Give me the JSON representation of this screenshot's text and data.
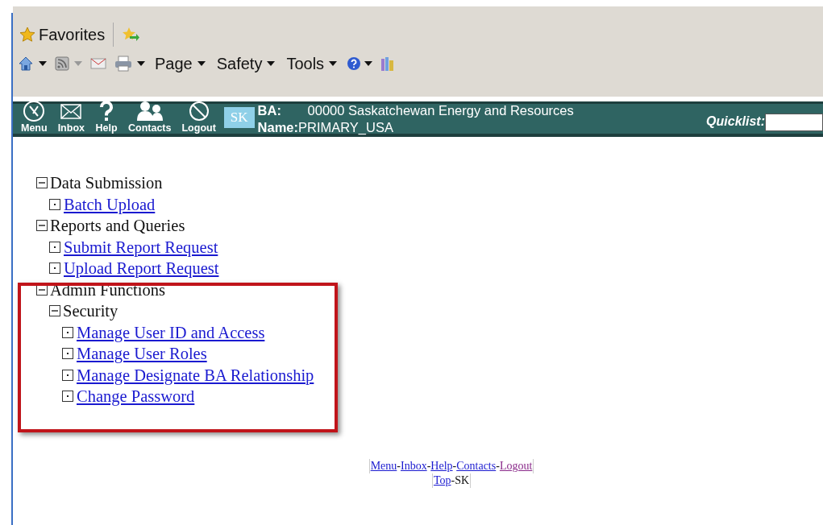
{
  "browser": {
    "favorites": "Favorites",
    "commands": [
      {
        "kind": "home"
      },
      {
        "kind": "feeds"
      },
      {
        "kind": "mail"
      },
      {
        "kind": "print"
      },
      {
        "kind": "menu",
        "label": "Page"
      },
      {
        "kind": "menu",
        "label": "Safety"
      },
      {
        "kind": "menu",
        "label": "Tools"
      },
      {
        "kind": "help"
      },
      {
        "kind": "research"
      }
    ]
  },
  "header": {
    "buttons": [
      {
        "kind": "menu",
        "label": "Menu"
      },
      {
        "kind": "inbox",
        "label": "Inbox"
      },
      {
        "kind": "help",
        "label": "Help"
      },
      {
        "kind": "contacts",
        "label": "Contacts"
      },
      {
        "kind": "logout",
        "label": "Logout"
      }
    ],
    "badge": "SK",
    "ba_label": "BA:",
    "ba_value": "00000 Saskatchewan Energy and Resources",
    "name_label": "Name:",
    "name_value": "PRIMARY_USA",
    "quicklist_label": "Quicklist:"
  },
  "tree": [
    {
      "kind": "group",
      "label": "Data Submission",
      "expanded": true,
      "children": [
        {
          "kind": "link",
          "label": "Batch Upload"
        }
      ]
    },
    {
      "kind": "group",
      "label": "Reports and Queries",
      "expanded": true,
      "children": [
        {
          "kind": "link",
          "label": "Submit Report Request"
        },
        {
          "kind": "link",
          "label": "Upload Report Request"
        }
      ]
    },
    {
      "kind": "group",
      "label": "Admin Functions",
      "expanded": true,
      "children": [
        {
          "kind": "group",
          "label": "Security",
          "expanded": true,
          "children": [
            {
              "kind": "link",
              "label": "Manage User ID and Access"
            },
            {
              "kind": "link",
              "label": "Manage User Roles"
            },
            {
              "kind": "link",
              "label": "Manage Designate BA Relationship"
            },
            {
              "kind": "link",
              "label": "Change Password"
            }
          ]
        }
      ]
    }
  ],
  "footer": [
    [
      {
        "kind": "link",
        "text": "Menu",
        "visited": false
      },
      {
        "kind": "text",
        "text": "-"
      },
      {
        "kind": "link",
        "text": "Inbox",
        "visited": false
      },
      {
        "kind": "text",
        "text": "-"
      },
      {
        "kind": "link",
        "text": "Help",
        "visited": false
      },
      {
        "kind": "text",
        "text": "-"
      },
      {
        "kind": "link",
        "text": "Contacts",
        "visited": false
      },
      {
        "kind": "text",
        "text": "-"
      },
      {
        "kind": "link",
        "text": "Logout",
        "visited": true
      }
    ],
    [
      {
        "kind": "link",
        "text": "Top",
        "visited": false
      },
      {
        "kind": "text",
        "text": "-SK"
      }
    ]
  ]
}
